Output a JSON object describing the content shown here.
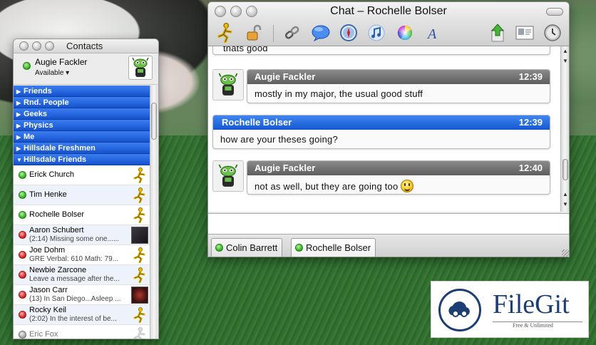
{
  "contacts_window": {
    "title": "Contacts",
    "user": {
      "name": "Augie Fackler",
      "status": "Available ▾"
    },
    "groups": [
      {
        "name": "Friends",
        "expanded": false
      },
      {
        "name": "Rnd. People",
        "expanded": false
      },
      {
        "name": "Geeks",
        "expanded": false
      },
      {
        "name": "Physics",
        "expanded": false
      },
      {
        "name": "Me",
        "expanded": false
      },
      {
        "name": "Hillsdale Freshmen",
        "expanded": false
      },
      {
        "name": "Hillsdale Friends",
        "expanded": true
      }
    ],
    "contacts": [
      {
        "name": "Erick Church",
        "info": "",
        "status": "available"
      },
      {
        "name": "Tim Henke",
        "info": "",
        "status": "available"
      },
      {
        "name": "Rochelle Bolser",
        "info": "",
        "status": "available"
      },
      {
        "name": "Aaron Schubert",
        "info": "(2:14) Missing some one......",
        "status": "away"
      },
      {
        "name": "Joe Dohm",
        "info": "GRE Verbal: 610 Math: 79...",
        "status": "away"
      },
      {
        "name": "Newbie Zarcone",
        "info": "Leave a message after the...",
        "status": "away"
      },
      {
        "name": "Jason Carr",
        "info": "(13) In San Diego...Asleep ...",
        "status": "away"
      },
      {
        "name": "Rocky Keil",
        "info": "(2:02) In the interest of be...",
        "status": "away"
      },
      {
        "name": "Eric Fox",
        "info": "",
        "status": "idle"
      }
    ]
  },
  "chat_window": {
    "title": "Chat – Rochelle Bolser",
    "toolbar_icons": [
      "aim-runner-icon",
      "lock-icon",
      "link-icon",
      "speech-bubble-icon",
      "compass-icon",
      "music-note-icon",
      "color-wheel-icon",
      "font-icon",
      "send-file-icon",
      "info-card-icon",
      "clock-icon"
    ],
    "partial_message": "thats good",
    "messages": [
      {
        "sender": "Augie Fackler",
        "time": "12:39",
        "text": "mostly in my major, the usual good stuff",
        "self": false
      },
      {
        "sender": "Rochelle Bolser",
        "time": "12:39",
        "text": "how are your theses going?",
        "self": true
      },
      {
        "sender": "Augie Fackler",
        "time": "12:40",
        "text": "not as well, but they are going too",
        "self": false,
        "emoticon": "smiley"
      }
    ],
    "input_value": "",
    "tabs": [
      {
        "label": "Colin Barrett",
        "active": false
      },
      {
        "label": "Rochelle Bolser",
        "active": true
      }
    ]
  },
  "watermark": {
    "brand": "FileGit",
    "tagline": "Free & Unlimited"
  },
  "colors": {
    "group_blue": "#1553cf",
    "available_green": "#3fbf2b",
    "away_red": "#e23030",
    "self_header_blue": "#2f73e6",
    "other_header_gray": "#6c6c6c",
    "brand_navy": "#1c3e72"
  }
}
